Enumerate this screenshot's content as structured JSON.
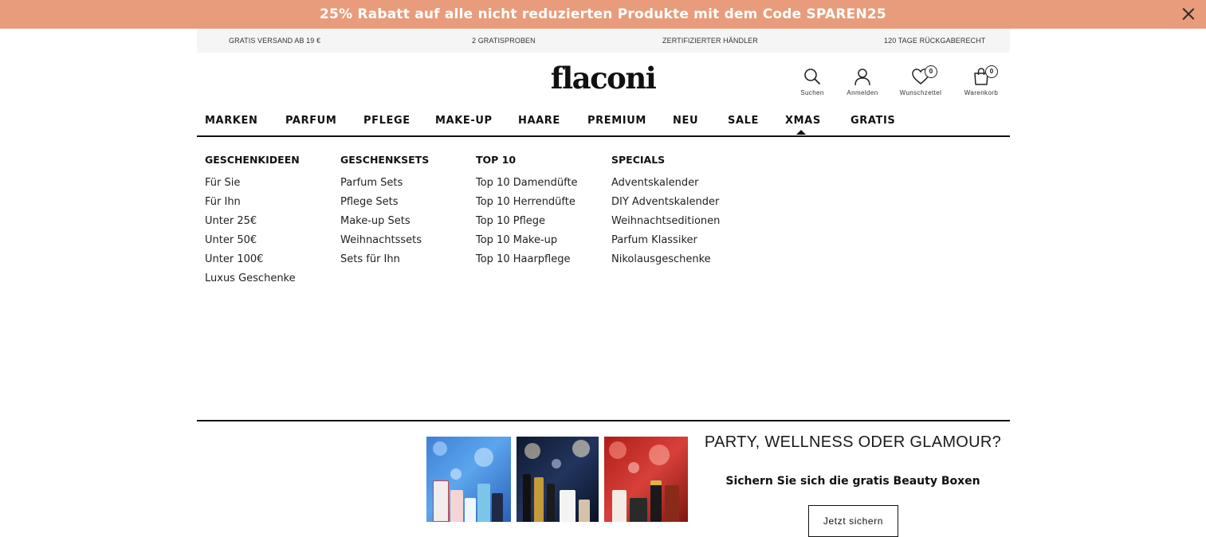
{
  "promo_banner": {
    "text": "25% Rabatt auf alle nicht reduzierten Produkte mit dem Code SPAREN25",
    "close_icon": "close-icon"
  },
  "usp_bar": {
    "items": [
      "GRATIS VERSAND AB 19 €",
      "2 GRATISPROBEN",
      "ZERTIFIZIERTER HÄNDLER",
      "120 TAGE RÜCKGABERECHT"
    ]
  },
  "header": {
    "logo": "flaconi",
    "icons": {
      "search": {
        "label": "Suchen",
        "icon": "search-icon"
      },
      "login": {
        "label": "Anmelden",
        "icon": "user-icon"
      },
      "wishlist": {
        "label": "Wunschzettel",
        "icon": "heart-icon",
        "count": "0"
      },
      "cart": {
        "label": "Warenkorb",
        "icon": "shopping-bag-icon",
        "count": "0"
      }
    }
  },
  "nav": {
    "items": [
      "MARKEN",
      "PARFUM",
      "PFLEGE",
      "MAKE-UP",
      "HAARE",
      "PREMIUM",
      "NEU",
      "SALE",
      "XMAS",
      "GRATIS"
    ],
    "active": "XMAS"
  },
  "mega_menu": {
    "columns": [
      {
        "heading": "GESCHENKIDEEN",
        "links": [
          "Für Sie",
          "Für Ihn",
          "Unter 25€",
          "Unter 50€",
          "Unter 100€",
          "Luxus Geschenke"
        ]
      },
      {
        "heading": "GESCHENKSETS",
        "links": [
          "Parfum Sets",
          "Pflege Sets",
          "Make-up Sets",
          "Weihnachtssets",
          "Sets für Ihn"
        ]
      },
      {
        "heading": "TOP 10",
        "links": [
          "Top 10 Damendüfte",
          "Top 10 Herrendüfte",
          "Top 10 Pflege",
          "Top 10 Make-up",
          "Top 10 Haarpflege"
        ]
      },
      {
        "heading": "SPECIALS",
        "links": [
          "Adventskalender",
          "DIY Adventskalender",
          "Weihnachtseditionen",
          "Parfum Klassiker",
          "Nikolausgeschenke"
        ]
      }
    ]
  },
  "teaser": {
    "title": "PARTY, WELLNESS ODER GLAMOUR?",
    "subtitle": "Sichern Sie sich die gratis Beauty Boxen",
    "button": "Jetzt sichern",
    "colors": {
      "box1": "#4a90e2",
      "box2": "#1a2744",
      "box3": "#c52a22"
    }
  },
  "colors": {
    "promo_bg": "#e89c7b",
    "usp_bg": "#f5f5f5",
    "text": "#111111"
  }
}
